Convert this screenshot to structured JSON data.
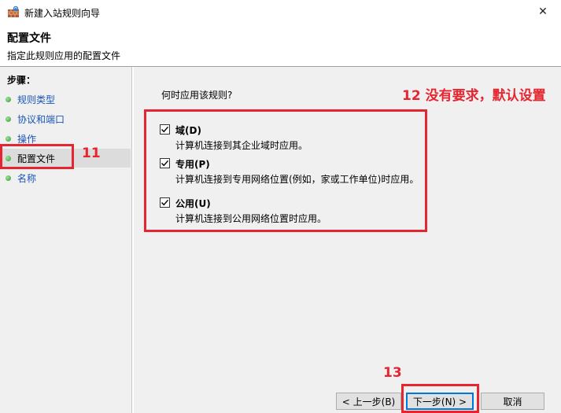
{
  "window": {
    "title": "新建入站规则向导",
    "close_glyph": "✕"
  },
  "header": {
    "title": "配置文件",
    "subtitle": "指定此规则应用的配置文件"
  },
  "sidebar": {
    "title": "步骤：",
    "items": [
      {
        "label": "规则类型"
      },
      {
        "label": "协议和端口"
      },
      {
        "label": "操作"
      },
      {
        "label": "配置文件"
      },
      {
        "label": "名称"
      }
    ]
  },
  "main": {
    "question": "何时应用该规则?",
    "options": [
      {
        "title": "域(D)",
        "desc": "计算机连接到其企业域时应用。",
        "checked": true
      },
      {
        "title": "专用(P)",
        "desc": "计算机连接到专用网络位置(例如，家或工作单位)时应用。",
        "checked": true
      },
      {
        "title": "公用(U)",
        "desc": "计算机连接到公用网络位置时应用。",
        "checked": true
      }
    ]
  },
  "buttons": {
    "back": "< 上一步(B)",
    "next": "下一步(N) >",
    "cancel": "取消"
  },
  "annotations": {
    "a11": "11",
    "a12": "12 没有要求，默认设置",
    "a13": "13",
    "color": "#e52530"
  }
}
